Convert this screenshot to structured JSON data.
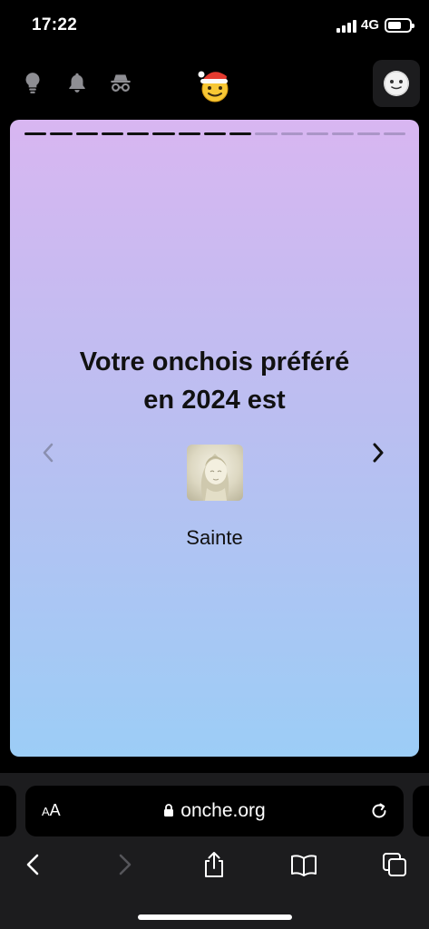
{
  "status_bar": {
    "time": "17:22",
    "network": "4G"
  },
  "card": {
    "title": "Votre onchois préféré\nen 2024 est",
    "sticker_name": "Sainte",
    "progress": {
      "total": 15,
      "completed": 9
    }
  },
  "browser": {
    "aa_label_small": "A",
    "aa_label_large": "A",
    "url": "onche.org"
  },
  "colors": {
    "gradient_top": "#d8b6f1",
    "gradient_bottom": "#9ccdf6"
  },
  "icons": {
    "top_nav": [
      "lightbulb-icon",
      "bell-icon",
      "incognito-icon",
      "santa-emoji-logo",
      "avatar-icon"
    ],
    "toolbar": [
      "back-icon",
      "forward-icon",
      "share-icon",
      "bookmarks-icon",
      "tabs-icon"
    ]
  }
}
